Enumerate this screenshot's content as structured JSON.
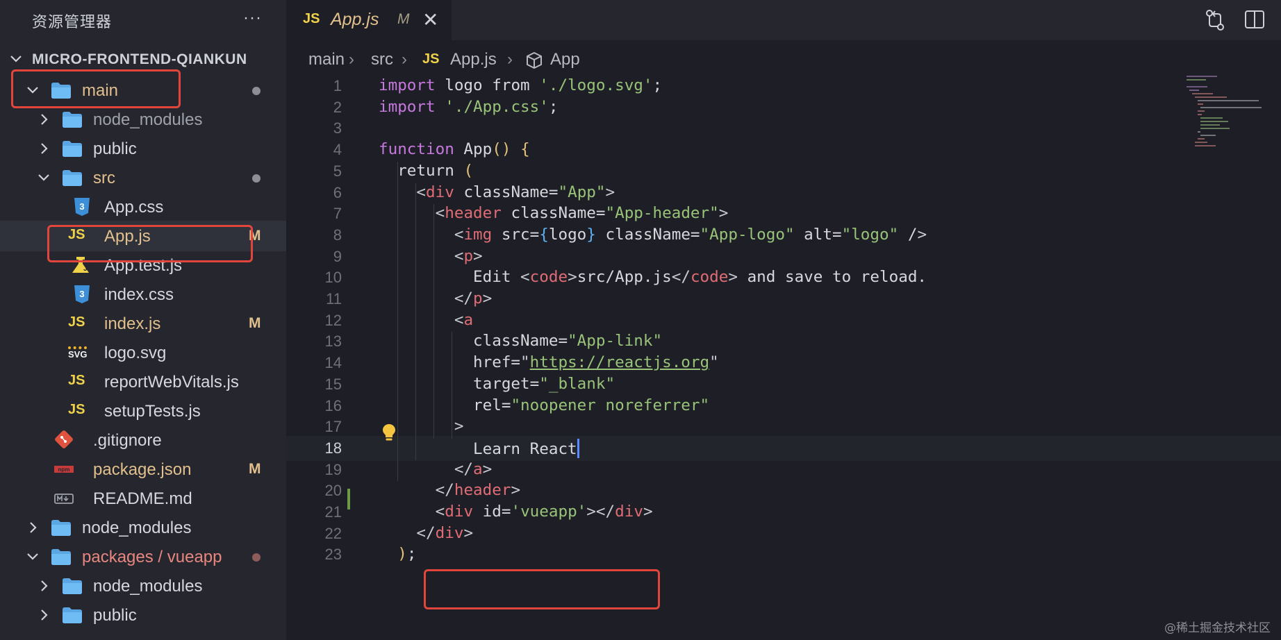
{
  "sidebar": {
    "title": "资源管理器",
    "more_label": "···",
    "project": "MICRO-FRONTEND-QIANKUN",
    "items": [
      {
        "label": "main",
        "kind": "folder-open",
        "badge": "dot"
      },
      {
        "label": "node_modules",
        "kind": "folder",
        "dim": true
      },
      {
        "label": "public",
        "kind": "folder"
      },
      {
        "label": "src",
        "kind": "folder-open",
        "badge": "dot"
      },
      {
        "label": "App.css",
        "kind": "css"
      },
      {
        "label": "App.js",
        "kind": "js",
        "badge": "M",
        "active": true
      },
      {
        "label": "App.test.js",
        "kind": "test"
      },
      {
        "label": "index.css",
        "kind": "css"
      },
      {
        "label": "index.js",
        "kind": "js",
        "badge": "M"
      },
      {
        "label": "logo.svg",
        "kind": "svg"
      },
      {
        "label": "reportWebVitals.js",
        "kind": "js"
      },
      {
        "label": "setupTests.js",
        "kind": "js"
      },
      {
        "label": ".gitignore",
        "kind": "git"
      },
      {
        "label": "package.json",
        "kind": "npm",
        "badge": "M"
      },
      {
        "label": "README.md",
        "kind": "md"
      },
      {
        "label": "node_modules",
        "kind": "folder"
      },
      {
        "label": "packages / vueapp",
        "kind": "folder-open",
        "badge": "dot-red"
      },
      {
        "label": "node_modules",
        "kind": "folder"
      },
      {
        "label": "public",
        "kind": "folder"
      }
    ],
    "modified_badge": "M",
    "svg_badge": "SVG",
    "js_badge": "JS"
  },
  "tab": {
    "icon": "JS",
    "title": "App.js",
    "status": "M",
    "close": "✕"
  },
  "breadcrumb": {
    "parts": [
      "main",
      "src",
      "App.js",
      "App"
    ],
    "js_icon": "JS"
  },
  "code": {
    "current_line": 18,
    "line_numbers": [
      "1",
      "2",
      "3",
      "4",
      "5",
      "6",
      "7",
      "8",
      "9",
      "10",
      "11",
      "12",
      "13",
      "14",
      "15",
      "16",
      "17",
      "18",
      "19",
      "20",
      "21",
      "22",
      "23"
    ],
    "lines": [
      "import logo from './logo.svg';",
      "import './App.css';",
      "",
      "function App() {",
      "  return (",
      "    <div className=\"App\">",
      "      <header className=\"App-header\">",
      "        <img src={logo} className=\"App-logo\" alt=\"logo\" />",
      "        <p>",
      "          Edit <code>src/App.js</code> and save to reload.",
      "        </p>",
      "        <a",
      "          className=\"App-link\"",
      "          href=\"https://reactjs.org\"",
      "          target=\"_blank\"",
      "          rel=\"noopener noreferrer\"",
      "        >",
      "          Learn React",
      "        </a>",
      "      </header>",
      "      <div id='vueapp'></div>",
      "    </div>",
      "  );"
    ]
  },
  "watermark": "@稀土掘金技术社区",
  "colors": {
    "highlight": "#e2453c",
    "keyword": "#c678dd",
    "string": "#98c379",
    "function": "#61afef",
    "tag": "#e06c75",
    "attr": "#e5c07b"
  }
}
